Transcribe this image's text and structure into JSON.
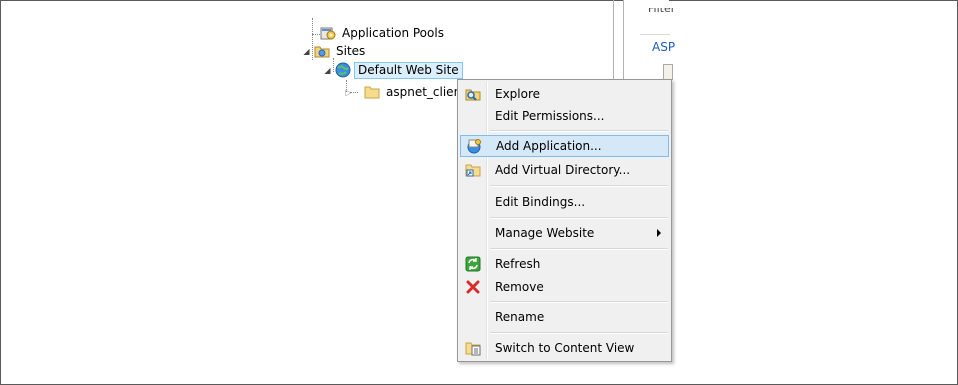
{
  "tree": {
    "app_pools": "Application Pools",
    "sites": "Sites",
    "default_site": "Default Web Site",
    "aspnet_client": "aspnet_client"
  },
  "right_panel": {
    "filter": "Filter",
    "asp": "ASP"
  },
  "menu": {
    "explore": "Explore",
    "edit_permissions": "Edit Permissions...",
    "add_application": "Add Application...",
    "add_virtual_directory": "Add Virtual Directory...",
    "edit_bindings": "Edit Bindings...",
    "manage_website": "Manage Website",
    "refresh": "Refresh",
    "remove": "Remove",
    "rename": "Rename",
    "switch_content_view": "Switch to Content View"
  },
  "colors": {
    "hover_bg": "#d5e8f8",
    "hover_border": "#7ebdec",
    "selection_bg": "#dbeefb",
    "remove_x": "#d92b2b",
    "refresh_green": "#3da33d",
    "asp_link": "#1e5dbb"
  }
}
